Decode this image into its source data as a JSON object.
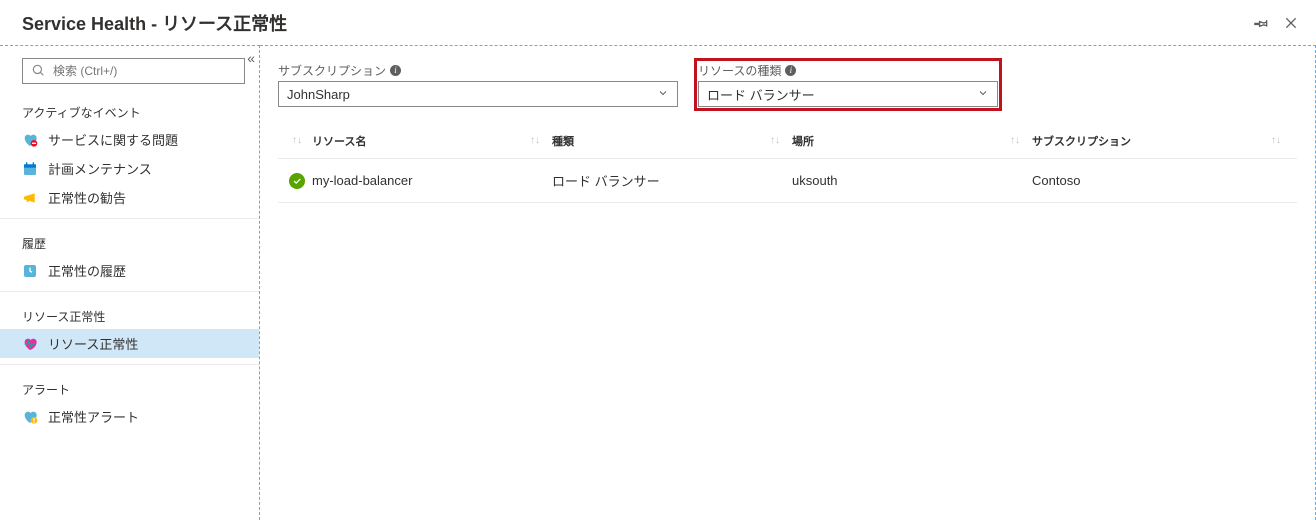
{
  "header": {
    "title": "Service Health - リソース正常性"
  },
  "search": {
    "placeholder": "検索 (Ctrl+/)"
  },
  "nav": {
    "sections": [
      {
        "title": "アクティブなイベント",
        "items": [
          {
            "label": "サービスに関する問題"
          },
          {
            "label": "計画メンテナンス"
          },
          {
            "label": "正常性の勧告"
          }
        ]
      },
      {
        "title": "履歴",
        "items": [
          {
            "label": "正常性の履歴"
          }
        ]
      },
      {
        "title": "リソース正常性",
        "items": [
          {
            "label": "リソース正常性"
          }
        ]
      },
      {
        "title": "アラート",
        "items": [
          {
            "label": "正常性アラート"
          }
        ]
      }
    ]
  },
  "filters": {
    "subscription": {
      "label": "サブスクリプション",
      "value": "JohnSharp"
    },
    "resourceType": {
      "label": "リソースの種類",
      "value": "ロード バランサー"
    }
  },
  "table": {
    "columns": {
      "name": "リソース名",
      "type": "種類",
      "location": "場所",
      "subscription": "サブスクリプション"
    },
    "rows": [
      {
        "status": "healthy",
        "name": "my-load-balancer",
        "type": "ロード バランサー",
        "location": "uksouth",
        "subscription": "Contoso"
      }
    ]
  }
}
